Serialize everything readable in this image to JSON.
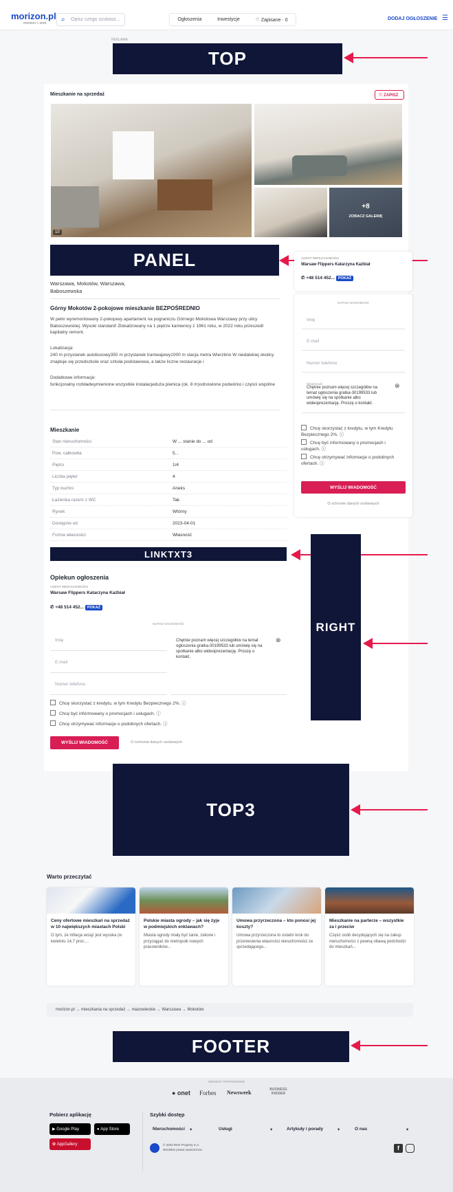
{
  "header": {
    "logo": "morizon.pl",
    "logo_sub": "morizon + onet",
    "search_placeholder": "Opisz czego szukasz...",
    "nav": [
      "Ogłoszenia",
      "Inwestycje",
      "♡ Zapisane · 0"
    ],
    "add_button": "DODAJ OGŁOSZENIE",
    "menu_icon": "☰"
  },
  "ads": {
    "top": "TOP",
    "top_label": "REKLAMA",
    "panel": "PANEL",
    "linktxt": "LINKTXT3",
    "right": "RIGHT",
    "top3": "TOP3",
    "footer": "FOOTER",
    "arrow_color": "#e6194b",
    "ad_color": "#0f1637"
  },
  "listing": {
    "type_label": "Mieszkanie na sprzedaż",
    "save_label": "♡ ZAPISZ",
    "photo_count": "10",
    "gallery_more": "+8",
    "gallery_label": "ZOBACZ GALERIĘ",
    "location": "Warszawa, Mokotów, Warszawa, Baboszewska",
    "title": "Górny Mokotów 2-pokojowe mieszkanie BEZPOŚREDNIO",
    "desc1": "W pełni wyremontowany 2-pokojowy apartament na pograniczu Górnego Mokotowa Warszawy przy ulicy Baboszewskiej. Wysoki standard! Zlokalizowany na 1 piętrze kamienicy z 1961 roku, w 2022 roku przeszedł kapitalny remont.",
    "desc2_title": "Lokalizacja:",
    "desc2": "240 m przystanek autobusowy350 m przystanek tramwajowy1000 m stacja metra Wierzbno W niedalekiej okolicy znajduje się przedszkole oraz szkoła podstawowa, a także liczne restauracje i",
    "desc3_title": "Dodatkowe informacje:",
    "desc3": "funkcjonalny rozkładwymienione wszystkie instalacjeduża piwnica (ok. 8 m)odnowione podwórko i części wspólne",
    "details_title": "Mieszkanie",
    "details": [
      {
        "k": "Stan nieruchomości",
        "v": "W ... stanie do ... od"
      },
      {
        "k": "Pow. całkowita",
        "v": "5..."
      },
      {
        "k": "Piętro",
        "v": "1/4"
      },
      {
        "k": "Liczba pięter",
        "v": "4"
      },
      {
        "k": "Typ kuchni",
        "v": "Aneks"
      },
      {
        "k": "Łazienka razem z WC",
        "v": "Tak"
      },
      {
        "k": "Rynek",
        "v": "Wtórny"
      },
      {
        "k": "Dostępne od",
        "v": "2023-04-01"
      },
      {
        "k": "Forma własności",
        "v": "Własność"
      }
    ]
  },
  "agent": {
    "section_title": "Opiekun ogłoszenia",
    "label": "AGENT NIERUCHOMOŚCI",
    "name": "Warsaw Flippers Katarzyna Kaźbiał",
    "phone": "+48 514 452...",
    "show": "POKAŻ"
  },
  "form": {
    "label": "NAPISZ WIADOMOŚĆ",
    "name_ph": "Imię",
    "email_ph": "E-mail",
    "phone_ph": "Numer telefonu",
    "msg_label": "Wiadomość",
    "msg": "Chętnie poznam więcej szczegółów na temat ogłoszenia gratka-30199533 lub umówię się na spotkanie albo wideoprezentację. Proszę o kontakt.",
    "chk1": "Chcę skorzystać z kredytu, w tym Kredytu Bezpiecznego 2%. ⓘ",
    "chk2": "Chcę być informowany o promocjach i usługach. ⓘ",
    "chk3": "Chcę otrzymywać informacje o podobnych ofertach. ⓘ",
    "send": "WYŚLIJ WIADOMOŚĆ",
    "privacy": "O ochronie danych osobowych"
  },
  "read": {
    "title": "Warto przeczytać",
    "items": [
      {
        "t": "Ceny ofertowe mieszkań na sprzedaż w 10 największych miastach Polski",
        "d": "O tym, że inflacja wciąż jest wysoka (w kwietniu 14,7 proc...."
      },
      {
        "t": "Polskie miasta ogrody – jak się żyje w podmiejskich enklawach?",
        "d": "Miasta ogrody miały być tanie, zielone i przyciągać do metropolii nowych pracowników..."
      },
      {
        "t": "Umowa przyrzeczona – kto ponosi jej koszty?",
        "d": "Umowa przyrzeczona to ostatni krok do przeniesienia własności nieruchomości ze sprzedającego..."
      },
      {
        "t": "Mieszkanie na parterze – wszystkie za i przeciw",
        "d": "Część osób decydujących się na zakup nieruchomości z pewną obawą podchodzi do mieszkań..."
      }
    ]
  },
  "breadcrumb": "morizon.pl  →  mieszkania na sprzedaż  →  mazowieckie  →  Warszawa  →  Mokotów",
  "footer": {
    "partners_label": "SERWISY PARTNERSKIE",
    "partners": [
      "● onet",
      "Forbes",
      "Newsweek",
      "BUSINESS INSIDER"
    ],
    "apps_title": "Pobierz aplikację",
    "stores": [
      "Google Play",
      "App Store",
      "AppGallery"
    ],
    "quick_title": "Szybki dostęp",
    "links": [
      "Nieruchomości",
      "Usługi",
      "Artykuły i porady",
      "O nas"
    ],
    "copyright": "© 2023 RKN Property S.A.",
    "rights": "Wszelkie prawa zastrzeżone"
  }
}
